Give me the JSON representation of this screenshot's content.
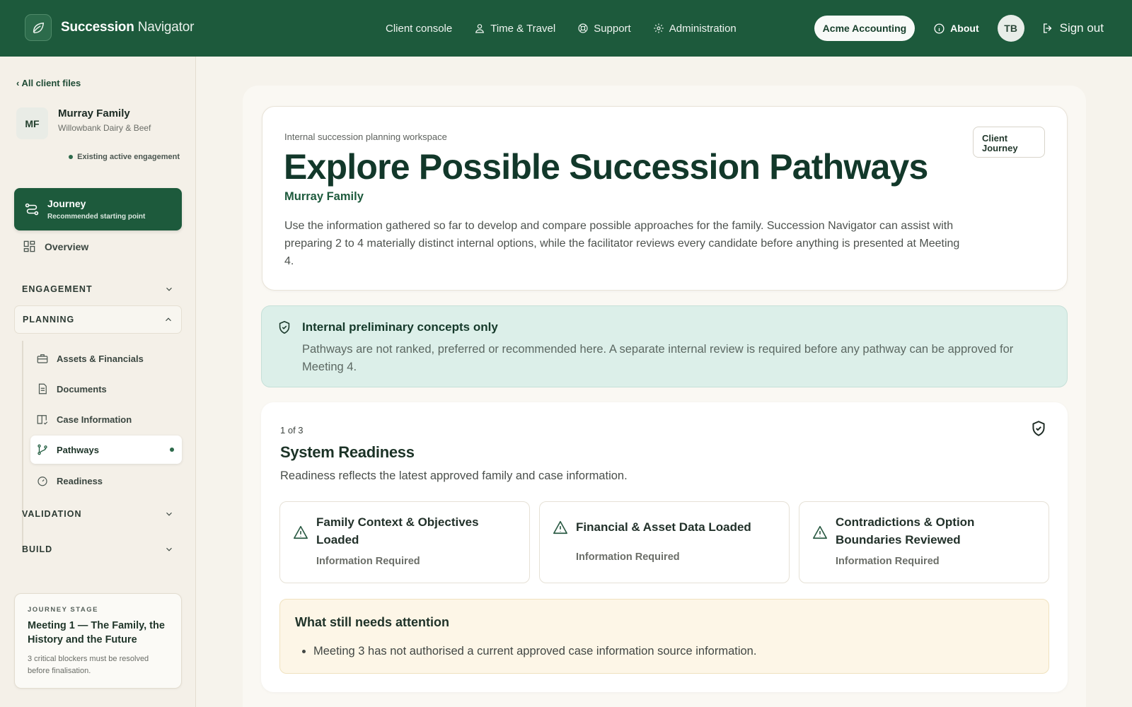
{
  "brand": {
    "name_bold": "Succession",
    "name_rest": "Navigator"
  },
  "topnav": [
    {
      "label": "Client console",
      "icon": "none"
    },
    {
      "label": "Time & Travel",
      "icon": "person-icon"
    },
    {
      "label": "Support",
      "icon": "lifebuoy-icon"
    },
    {
      "label": "Administration",
      "icon": "gear-icon"
    }
  ],
  "user": {
    "org": "Acme Accounting",
    "about": "About",
    "initials": "TB",
    "signout": "Sign out"
  },
  "sidebar": {
    "back": "‹ All client files",
    "client": {
      "initials": "MF",
      "name": "Murray Family",
      "business": "Willowbank Dairy & Beef"
    },
    "engagement_status": "Existing active engagement",
    "journey": {
      "title": "Journey",
      "subtitle": "Recommended starting point"
    },
    "overview": "Overview",
    "sections": {
      "engagement": "ENGAGEMENT",
      "planning": "PLANNING",
      "validation": "VALIDATION",
      "build": "BUILD"
    },
    "planning_items": [
      {
        "label": "Assets & Financials",
        "icon": "briefcase-icon"
      },
      {
        "label": "Documents",
        "icon": "document-icon"
      },
      {
        "label": "Case Information",
        "icon": "book-icon"
      },
      {
        "label": "Pathways",
        "icon": "branch-icon",
        "active": true
      },
      {
        "label": "Readiness",
        "icon": "gauge-icon"
      }
    ],
    "stage": {
      "kicker": "JOURNEY STAGE",
      "title": "Meeting 1 — The Family, the History and the Future",
      "note": "3 critical blockers must be resolved before finalisation."
    }
  },
  "header": {
    "eyebrow": "Internal succession planning workspace",
    "title": "Explore Possible Succession Pathways",
    "family": "Murray Family",
    "description": "Use the information gathered so far to develop and compare possible approaches for the family. Succession Navigator can assist with preparing 2 to 4 materially distinct internal options, while the facilitator reviews every candidate before anything is presented at Meeting 4.",
    "chip": "Client Journey"
  },
  "notice": {
    "title": "Internal preliminary concepts only",
    "body": "Pathways are not ranked, preferred or recommended here. A separate internal review is required before any pathway can be approved for Meeting 4."
  },
  "readiness": {
    "step": "1 of 3",
    "title": "System Readiness",
    "subtitle": "Readiness reflects the latest approved family and case information.",
    "checks": [
      {
        "title": "Family Context & Objectives Loaded",
        "status": "Information Required"
      },
      {
        "title": "Financial & Asset Data Loaded",
        "status": "Information Required"
      },
      {
        "title": "Contradictions & Option Boundaries Reviewed",
        "status": "Information Required"
      }
    ],
    "attention": {
      "title": "What still needs attention",
      "items": [
        "Meeting 3 has not authorised a current approved case information source information."
      ]
    }
  },
  "colors": {
    "brand_green": "#1d5a3c",
    "notice_bg": "#dcefe9",
    "attention_bg": "#fdf6e7",
    "page_bg": "#f6f3ec"
  }
}
